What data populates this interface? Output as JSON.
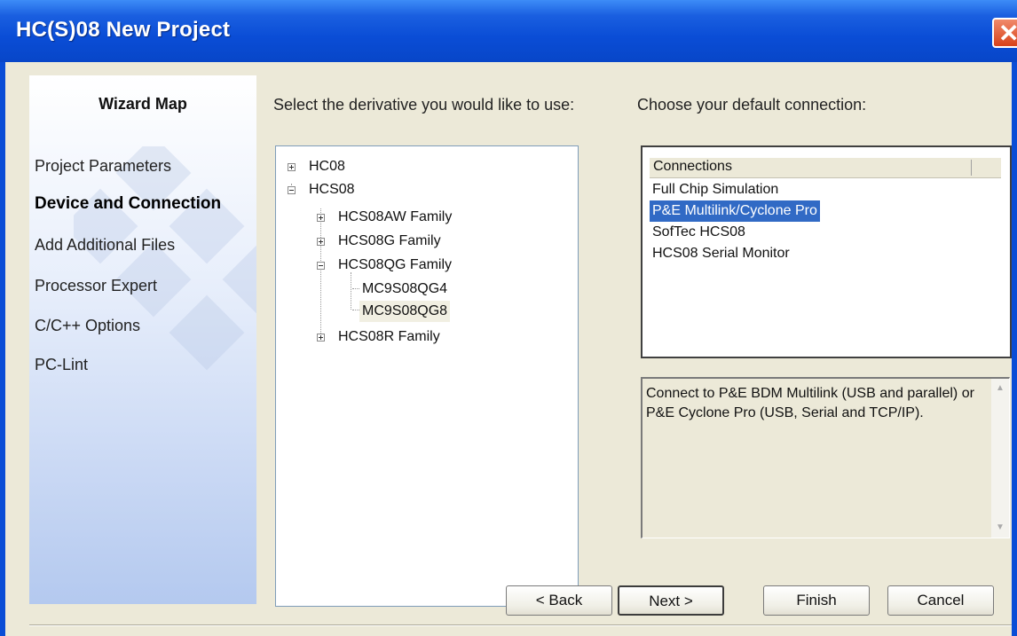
{
  "window": {
    "title": "HC(S)08 New Project"
  },
  "wizard": {
    "heading": "Wizard Map",
    "items": [
      {
        "label": "Project Parameters"
      },
      {
        "label": "Device and Connection"
      },
      {
        "label": "Add Additional Files"
      },
      {
        "label": "Processor Expert"
      },
      {
        "label": "C/C++ Options"
      },
      {
        "label": "PC-Lint"
      }
    ],
    "active_index": 1
  },
  "derivative": {
    "prompt": "Select the derivative you would like to use:",
    "tree": [
      {
        "label": "HC08"
      },
      {
        "label": "HCS08"
      },
      {
        "label": "HCS08AW Family"
      },
      {
        "label": "HCS08G Family"
      },
      {
        "label": "HCS08QG Family"
      },
      {
        "label": "MC9S08QG4"
      },
      {
        "label": "MC9S08QG8"
      },
      {
        "label": "HCS08R Family"
      }
    ],
    "selected": "MC9S08QG8"
  },
  "connection": {
    "prompt": "Choose your default connection:",
    "column_header": "Connections",
    "options": [
      {
        "label": "Full Chip Simulation"
      },
      {
        "label": "P&E Multilink/Cyclone Pro"
      },
      {
        "label": "SofTec HCS08"
      },
      {
        "label": "HCS08 Serial Monitor"
      }
    ],
    "selected": "P&E Multilink/Cyclone Pro",
    "description": "Connect to P&E BDM Multilink (USB and parallel) or P&E Cyclone Pro (USB, Serial and TCP/IP)."
  },
  "buttons": {
    "back": "< Back",
    "next": "Next >",
    "finish": "Finish",
    "cancel": "Cancel"
  },
  "colors": {
    "titlebar": "#0a4dd6",
    "selection": "#316ac5",
    "dialog_bg": "#ece9d8"
  }
}
